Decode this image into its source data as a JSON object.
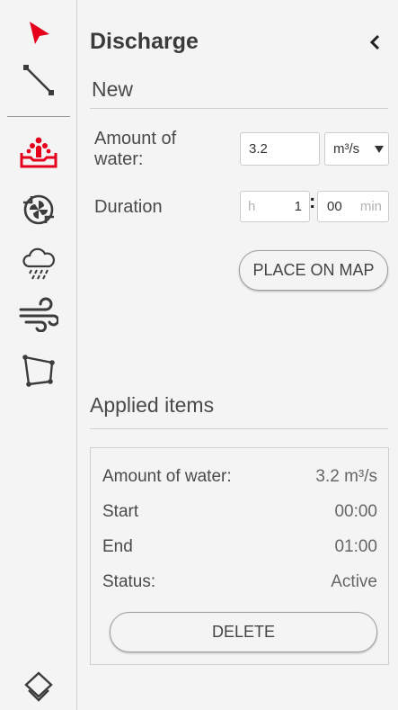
{
  "toolbar": {
    "tools": [
      {
        "name": "select-pointer-tool"
      },
      {
        "name": "line-tool"
      },
      {
        "name": "discharge-tool",
        "active": true
      },
      {
        "name": "pump-tool"
      },
      {
        "name": "rain-tool"
      },
      {
        "name": "wind-tool"
      },
      {
        "name": "polygon-tool"
      },
      {
        "name": "layers-tool"
      }
    ],
    "active_color": "#e5001c",
    "icon_color": "#3c3c3c"
  },
  "panel": {
    "title": "Discharge",
    "new_section": {
      "title": "New",
      "amount_label": "Amount of water:",
      "amount_value": "3.2",
      "unit_selected": "m³/s",
      "duration_label": "Duration",
      "hours_placeholder": "h",
      "hours_value": "1",
      "separator": ":",
      "minutes_value": "00",
      "minutes_placeholder": "min",
      "place_button": "PLACE ON MAP"
    },
    "applied_section": {
      "title": "Applied items",
      "items": [
        {
          "amount_label": "Amount of water:",
          "amount_value": "3.2 m³/s",
          "start_label": "Start",
          "start_value": "00:00",
          "end_label": "End",
          "end_value": "01:00",
          "status_label": "Status:",
          "status_value": "Active",
          "delete_button": "DELETE"
        }
      ]
    }
  }
}
